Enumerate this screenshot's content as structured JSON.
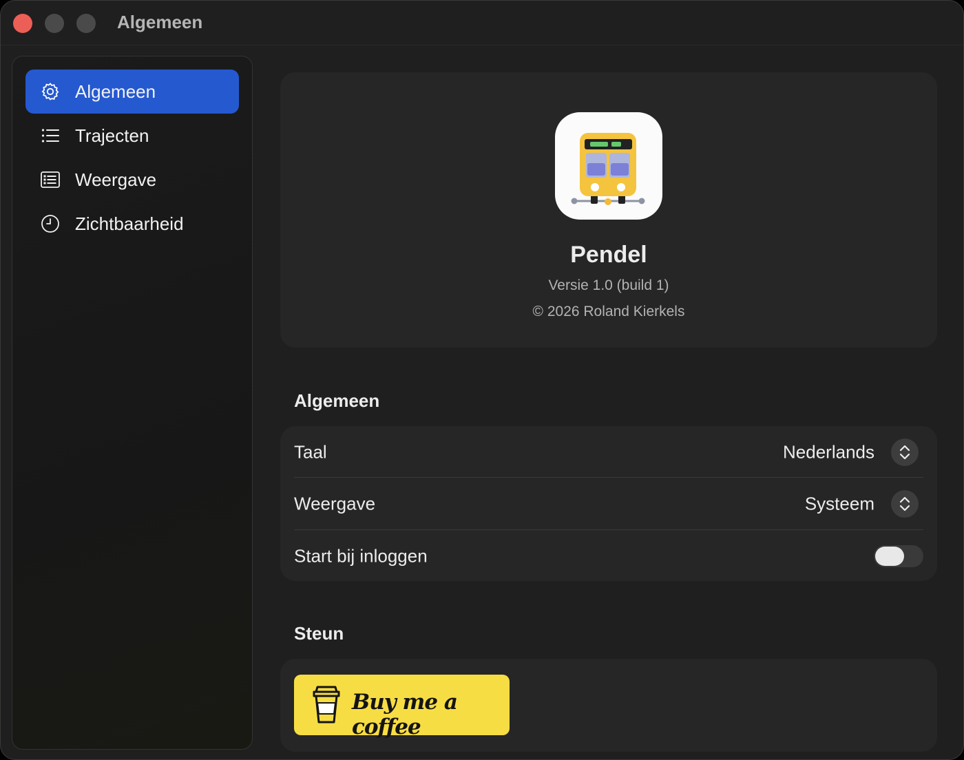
{
  "window": {
    "title": "Algemeen"
  },
  "sidebar": {
    "items": [
      {
        "label": "Algemeen",
        "icon": "gear-icon",
        "active": true
      },
      {
        "label": "Trajecten",
        "icon": "list-icon",
        "active": false
      },
      {
        "label": "Weergave",
        "icon": "display-icon",
        "active": false
      },
      {
        "label": "Zichtbaarheid",
        "icon": "clock-icon",
        "active": false
      }
    ]
  },
  "about": {
    "app_name": "Pendel",
    "version": "Versie 1.0 (build 1)",
    "copyright": "© 2026 Roland Kierkels",
    "icon": "train-app-icon"
  },
  "general": {
    "title": "Algemeen",
    "language": {
      "label": "Taal",
      "value": "Nederlands"
    },
    "appearance": {
      "label": "Weergave",
      "value": "Systeem"
    },
    "launch_at_login": {
      "label": "Start bij inloggen",
      "enabled": false
    }
  },
  "support": {
    "title": "Steun",
    "button_label": "Buy me a coffee",
    "button_color": "#f7dd44"
  },
  "colors": {
    "accent": "#2559d0",
    "close": "#ec5f57"
  }
}
